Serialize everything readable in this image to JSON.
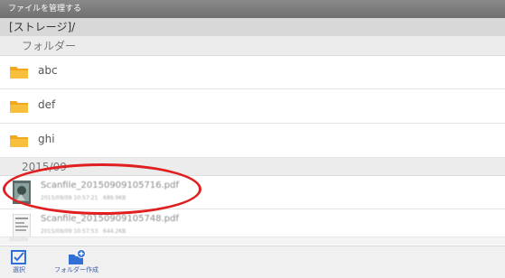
{
  "window": {
    "title": "ファイルを管理する"
  },
  "path": "[ストレージ]/",
  "sections": {
    "folders_header": "フォルダー",
    "files_header": "2015/09"
  },
  "folders": [
    {
      "label": "abc",
      "icon": "folder-icon"
    },
    {
      "label": "def",
      "icon": "folder-icon"
    },
    {
      "label": "ghi",
      "icon": "folder-icon"
    }
  ],
  "files": [
    {
      "name": "Scanfile_20150909105716.pdf",
      "date": "2015/09/09 10:57:21",
      "size": "689.9KB"
    },
    {
      "name": "Scanfile_20150909105748.pdf",
      "date": "2015/09/09 10:57:53",
      "size": "644.2KB"
    }
  ],
  "faded_label": "2015/09",
  "toolbar": {
    "select_label": "選択",
    "new_folder_label": "フォルダー作成"
  },
  "colors": {
    "titlebar": "#7c7c7c",
    "folder": "#f2a81d",
    "accent": "#2f6fd6",
    "annotation": "#e02020"
  }
}
